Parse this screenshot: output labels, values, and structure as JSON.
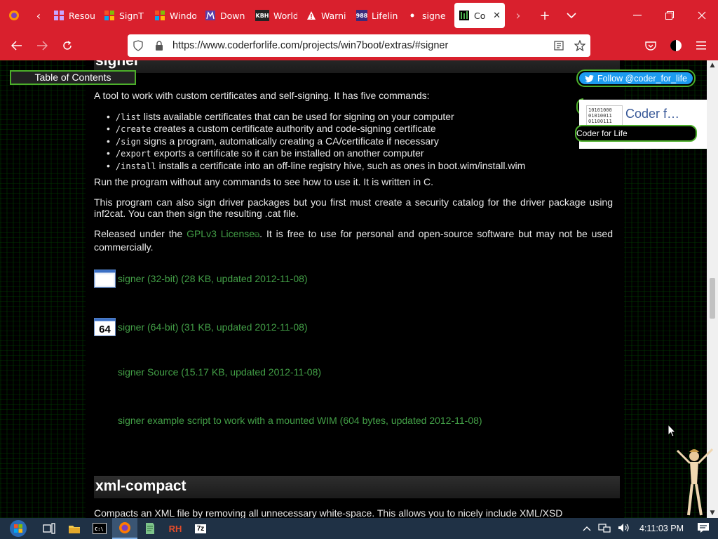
{
  "browser": {
    "tabs": [
      {
        "label": "Resou",
        "favicon": "grid-icon",
        "color": "#6b3fa0"
      },
      {
        "label": "SignT",
        "favicon": "windows-icon",
        "color": "#1e88e5"
      },
      {
        "label": "Windo",
        "favicon": "windows-icon",
        "color": "#1e88e5"
      },
      {
        "label": "Down",
        "favicon": "m-icon",
        "color": "#5b3ea8"
      },
      {
        "label": "World",
        "favicon": "KBH",
        "color": "#222222"
      },
      {
        "label": "Warni",
        "favicon": "warning-icon",
        "color": "#ffffff"
      },
      {
        "label": "Lifelin",
        "favicon": "988",
        "color": "#3a2a7a"
      },
      {
        "label": "signe",
        "favicon": "dot-icon",
        "color": "#ffffff"
      },
      {
        "label": "Co",
        "favicon": "coder-icon",
        "color": "#000000",
        "active": true
      }
    ],
    "url": "https://www.coderforlife.com/projects/win7boot/extras/#signer"
  },
  "page": {
    "toc_label": "Table of Contents",
    "follow_label": "Follow @coder_for_life",
    "fb_title": "Coder f…",
    "fb_subtitle": "Coder for Life",
    "fb_logo_text": "10101000\n01010011\n01100111",
    "signer_heading": "signer",
    "intro": "A tool to work with custom certificates and self-signing. It has five commands:",
    "commands": [
      {
        "cmd": "/list",
        "desc": " lists available certificates that can be used for signing on your computer"
      },
      {
        "cmd": "/create",
        "desc": " creates a custom certificate authority and code-signing certificate"
      },
      {
        "cmd": "/sign",
        "desc": " signs a program, automatically creating a CA/certificate if necessary"
      },
      {
        "cmd": "/export",
        "desc": " exports a certificate so it can be installed on another computer"
      },
      {
        "cmd": "/install",
        "desc": " installs a certificate into an off-line registry hive, such as ones in boot.wim/install.wim"
      }
    ],
    "run_text": "Run the program without any commands to see how to use it. It is written in C.",
    "driver_text": "This program can also sign driver packages but you first must create a security catalog for the driver package using inf2cat. You can then sign the resulting .cat file.",
    "released_before": "Released under the ",
    "license_link": "GPLv3 License",
    "released_after": ". It is free to use for personal and open-source software but may not be used commercially.",
    "downloads": [
      {
        "label": "signer (32-bit) (28 KB, updated 2012-11-08)",
        "icon": "window-32-icon"
      },
      {
        "label": "signer (64-bit) (31 KB, updated 2012-11-08)",
        "icon": "64-icon",
        "badge": "64"
      },
      {
        "label": "signer Source (15.17 KB, updated 2012-11-08)",
        "icon": ""
      },
      {
        "label": "signer example script to work with a mounted WIM (604 bytes, updated 2012-11-08)",
        "icon": ""
      }
    ],
    "xml_heading": "xml-compact",
    "xml_text": "Compacts an XML file by removing all unnecessary white-space. This allows you to nicely include XML/XSD"
  },
  "taskbar": {
    "apps": [
      "explorer",
      "cmd",
      "firefox",
      "notepad",
      "RH",
      "7z"
    ],
    "rh_label": "RH",
    "sevenzip_label": "7z",
    "cmd_label": "C:\\",
    "time": "4:11:03 PM"
  },
  "colors": {
    "accent": "#d9202d",
    "link": "#43a047",
    "border": "#4caf2a"
  }
}
